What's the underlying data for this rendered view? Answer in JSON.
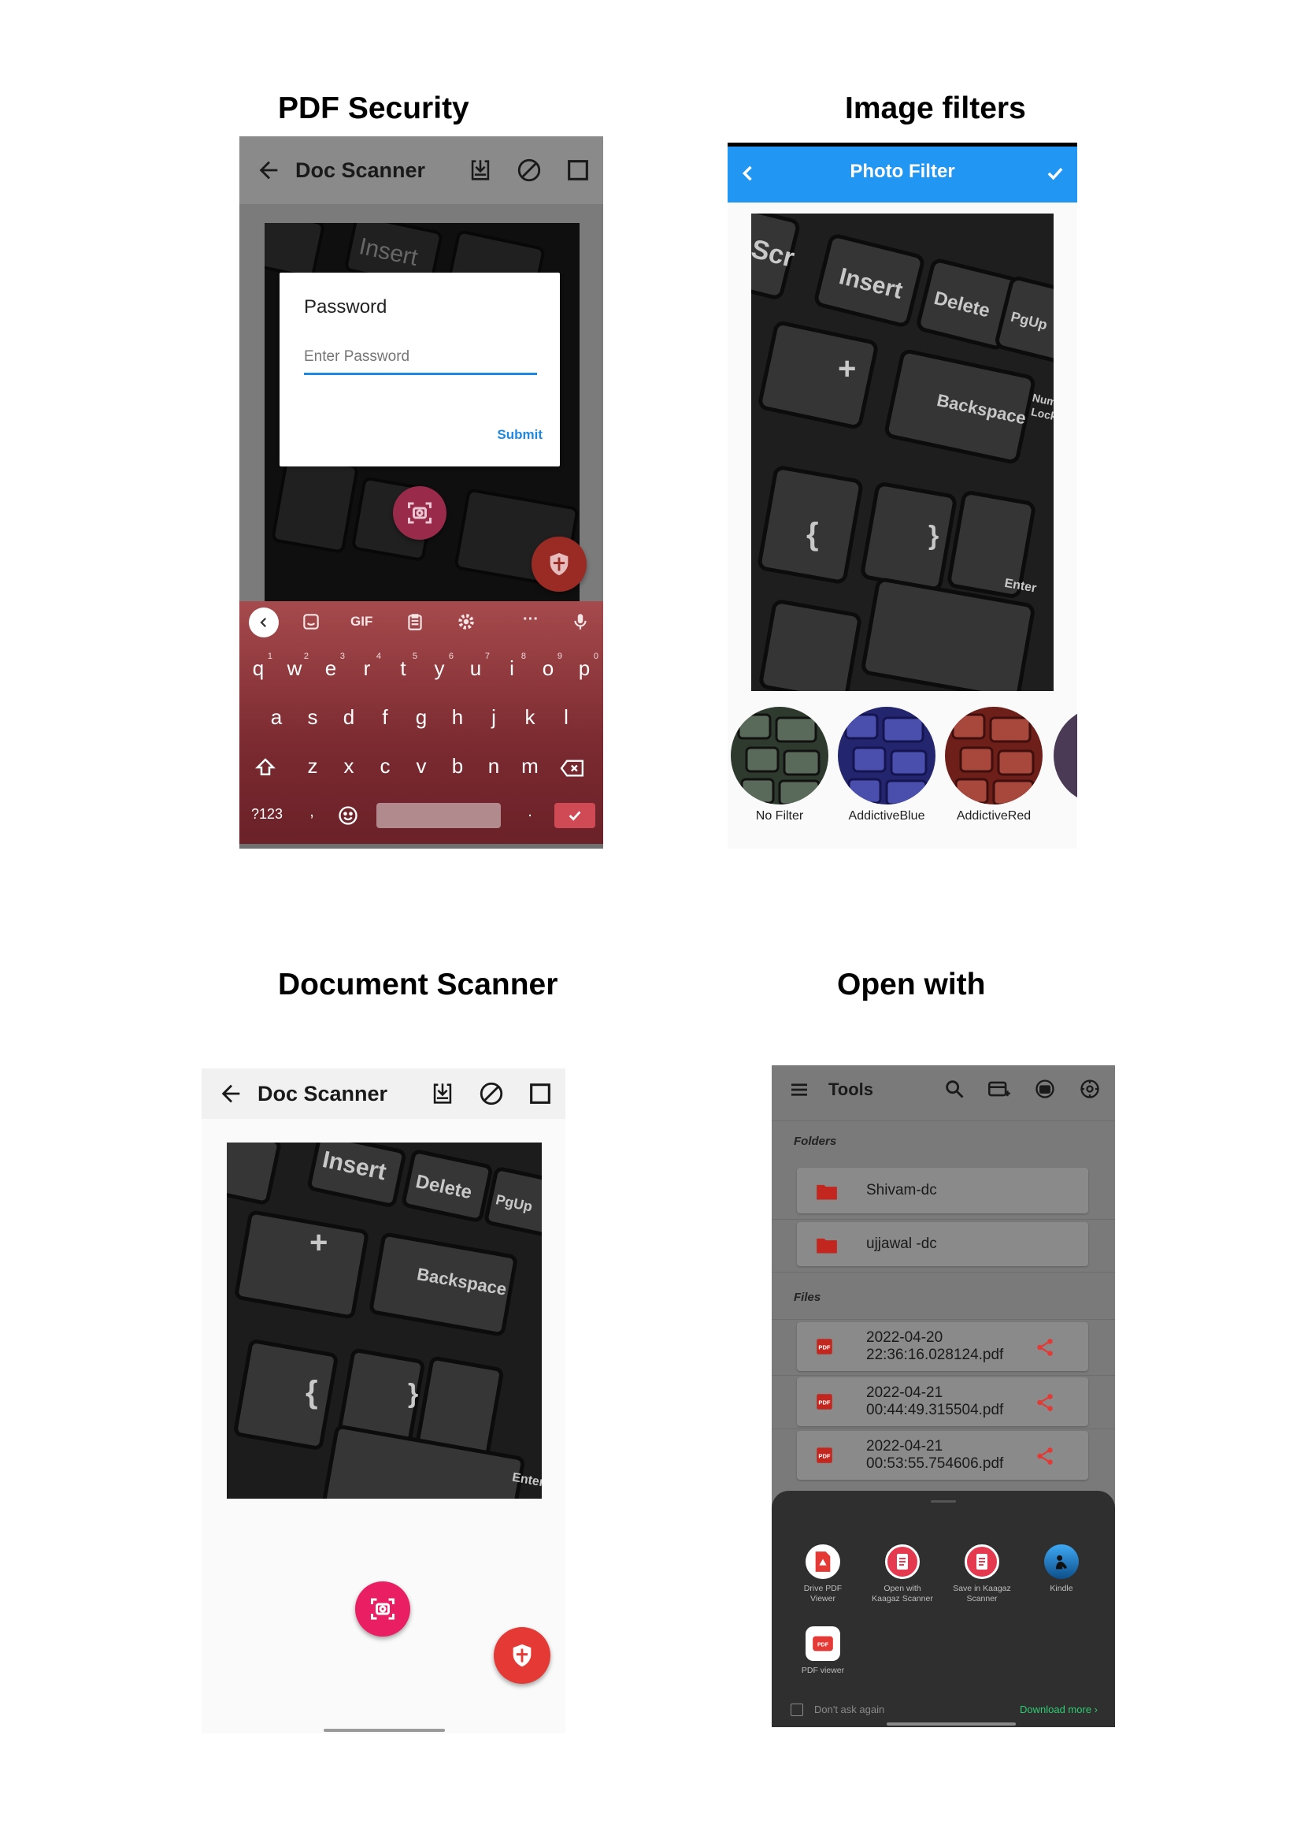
{
  "captions": {
    "pdf_security": "PDF Security",
    "image_filters": "Image filters",
    "document_scanner": "Document Scanner",
    "open_with": "Open with"
  },
  "pdf_security": {
    "app_title": "Doc Scanner",
    "dialog": {
      "title": "Password",
      "placeholder": "Enter Password",
      "submit": "Submit"
    },
    "keyboard": {
      "toolbar": [
        "GIF",
        "···"
      ],
      "row1": [
        "q",
        "w",
        "e",
        "r",
        "t",
        "y",
        "u",
        "i",
        "o",
        "p"
      ],
      "row1_hints": [
        "1",
        "2",
        "3",
        "4",
        "5",
        "6",
        "7",
        "8",
        "9",
        "0"
      ],
      "row2": [
        "a",
        "s",
        "d",
        "f",
        "g",
        "h",
        "j",
        "k",
        "l"
      ],
      "row3": [
        "z",
        "x",
        "c",
        "v",
        "b",
        "n",
        "m"
      ],
      "symbols_key": "?123",
      "comma": ",",
      "period": "."
    }
  },
  "photo_filter": {
    "title": "Photo Filter",
    "filters": [
      "No Filter",
      "AddictiveBlue",
      "AddictiveRed"
    ],
    "filter_tints": [
      "#3a4a3a",
      "#2b2e8c",
      "#8a2a24"
    ]
  },
  "doc_scanner": {
    "app_title": "Doc Scanner"
  },
  "open_with": {
    "title": "Tools",
    "folders_header": "Folders",
    "folders": [
      "Shivam-dc",
      "ujjawal -dc"
    ],
    "files_header": "Files",
    "files": [
      {
        "line1": "2022-04-20",
        "line2": "22:36:16.028124.pdf"
      },
      {
        "line1": "2022-04-21",
        "line2": "00:44:49.315504.pdf"
      },
      {
        "line1": "2022-04-21",
        "line2": "00:53:55.754606.pdf"
      }
    ],
    "apps": [
      {
        "l1": "Drive PDF",
        "l2": "Viewer"
      },
      {
        "l1": "Open with",
        "l2": "Kaagaz Scanner"
      },
      {
        "l1": "Save in Kaagaz",
        "l2": "Scanner"
      },
      {
        "l1": "Kindle",
        "l2": ""
      },
      {
        "l1": "PDF viewer",
        "l2": ""
      }
    ],
    "dont_ask": "Don't ask again",
    "download_more": "Download more",
    "colors": {
      "accent_red": "#e53935",
      "green_link": "#2ecc71"
    }
  },
  "photo_key_labels": [
    "Insert",
    "Delete",
    "PgUp",
    "Backspace",
    "Num",
    "Lock",
    "Enter",
    "Scr"
  ],
  "colors": {
    "fab_pink": "#e91e63",
    "fab_red": "#e53935",
    "blue_bar": "#2196f3",
    "keyboard_red": "#7a2a30"
  }
}
